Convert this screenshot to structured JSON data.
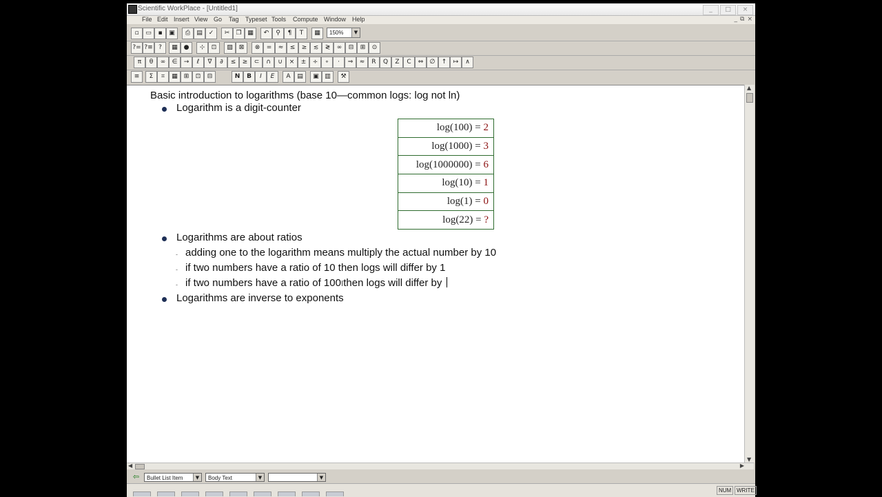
{
  "window": {
    "title": "Scientific WorkPlace - [Untitled1]",
    "buttons": [
      "_",
      "□",
      "×"
    ]
  },
  "menu": [
    "File",
    "Edit",
    "Insert",
    "View",
    "Go",
    "Tag",
    "Typeset",
    "Tools",
    "Compute",
    "Window",
    "Help"
  ],
  "doc_buttons": [
    "_",
    "⧉",
    "×"
  ],
  "toolbar1": {
    "zoom": "150%",
    "icons": [
      "new-icon",
      "open-icon",
      "save-icon",
      "save-all-icon",
      "print-icon",
      "preview-icon",
      "spell-icon",
      "cut-icon",
      "copy-icon",
      "paste-icon",
      "undo-icon",
      "find-icon",
      "pilcrow-icon",
      "text-icon",
      "table-icon"
    ],
    "glyphs": [
      "▫",
      "▭",
      "▪",
      "▣",
      "⎙",
      "▤",
      "✓",
      "✂",
      "❐",
      "▦",
      "↶",
      "⚲",
      "¶",
      "T",
      "▦"
    ]
  },
  "toolbar2": {
    "glyphs": [
      "?=",
      "?≡",
      "?",
      "▦",
      "●",
      "⊹",
      "⊡",
      "▨",
      "⊠",
      "⊗",
      "=",
      "≈",
      "≤",
      "≥",
      "≲",
      "≷",
      "∞",
      "⊟",
      "⊞",
      "⊙"
    ]
  },
  "toolbar3": {
    "glyphs": [
      "π",
      "θ",
      "∞",
      "∈",
      "→",
      "ℓ",
      "∇",
      "∂",
      "≤",
      "≥",
      "⊂",
      "∩",
      "∪",
      "×",
      "±",
      "÷",
      "∘",
      "·",
      "⇒",
      "≈",
      "R",
      "Q",
      "Z",
      "C",
      "⇔",
      "∅",
      "↑",
      "↦",
      "∧"
    ]
  },
  "toolbar4": {
    "glyphs": [
      "≡",
      "Σ",
      "⌗",
      "▦",
      "⊞",
      "⊡",
      "⊟",
      "N",
      "B",
      "I",
      "E",
      "A",
      "▤",
      "▣",
      "▥",
      "⚒"
    ]
  },
  "document": {
    "heading": "Basic introduction to logarithms (base 10—common logs: log not ln)",
    "bullet1": "Logarithm is a digit-counter",
    "table": [
      {
        "lhs": "log(100)",
        "eq": "=",
        "val": "2"
      },
      {
        "lhs": "log(1000)",
        "eq": "=",
        "val": "3"
      },
      {
        "lhs": "log(1000000)",
        "eq": "=",
        "val": "6"
      },
      {
        "lhs": "log(10)",
        "eq": "=",
        "val": "1"
      },
      {
        "lhs": "log(1)",
        "eq": "=",
        "val": "0"
      },
      {
        "lhs": "log(22)",
        "eq": "=",
        "val": "?"
      }
    ],
    "bullet2": "Logarithms are about ratios",
    "sub1": "adding one to the logarithm means multiply the actual number by 10",
    "sub2": "if two numbers have a ratio of 10 then logs will differ by 1",
    "sub3a": "if two numbers have a ratio of 100",
    "sub3b": "then logs will differ by",
    "bullet3": "Logarithms are inverse to exponents"
  },
  "statusbar": {
    "item_tag": "Bullet List Item",
    "text_tag": "Body Text",
    "other": ""
  },
  "status": {
    "num": "NUM",
    "write": "WRITE"
  },
  "colors": {
    "bullet": "#1e2f56",
    "table_border": "#2e6b2e",
    "math_value": "#8b1010"
  }
}
